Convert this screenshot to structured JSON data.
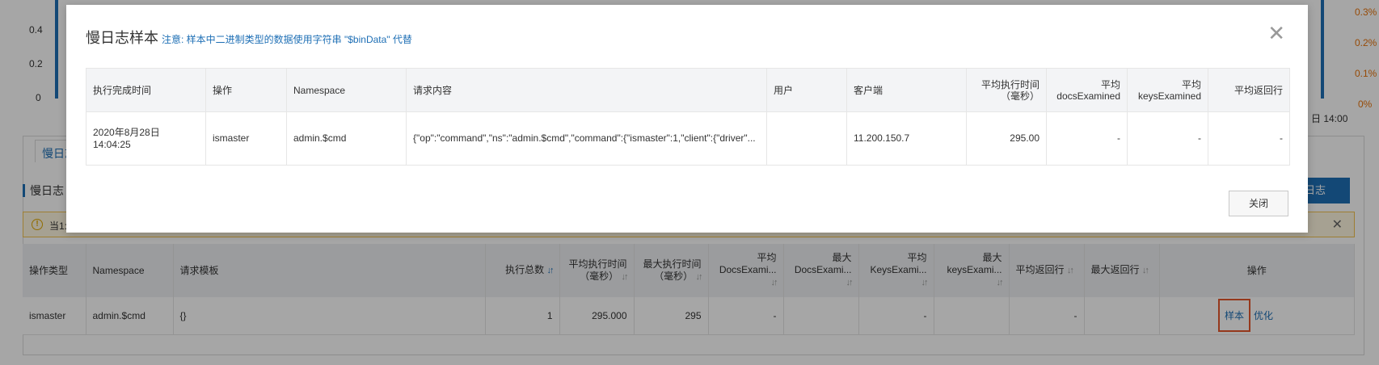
{
  "background": {
    "chart": {
      "y_left_ticks": [
        "0.4",
        "0.2",
        "0"
      ],
      "y_right_ticks": [
        "0.3%",
        "0.2%",
        "0.1%",
        "0%"
      ],
      "x_tick_right": "日 14:00"
    },
    "tab_label": "慢日志",
    "subhead": "慢日志",
    "action_button": "日志",
    "notice_text": "当1:"
  },
  "bottom_table": {
    "headers": [
      "操作类型",
      "Namespace",
      "请求模板",
      "执行总数",
      "平均执行时间（毫秒）",
      "最大执行时间（毫秒）",
      "平均 DocsExami...",
      "最大 DocsExami...",
      "平均 KeysExami...",
      "最大 keysExami...",
      "平均返回行",
      "最大返回行",
      "操作"
    ],
    "row": {
      "op_type": "ismaster",
      "namespace": "admin.$cmd",
      "template": "{}",
      "total": "1",
      "avg_time": "295.000",
      "max_time": "295",
      "avg_docs": "-",
      "max_docs": "",
      "avg_keys": "-",
      "max_keys": "",
      "avg_ret": "-",
      "max_ret": "",
      "action_sample": "样本",
      "action_optimize": "优化"
    }
  },
  "modal": {
    "title": "慢日志样本",
    "note": "注意: 样本中二进制类型的数据使用字符串 \"$binData\" 代替",
    "headers": [
      "执行完成时间",
      "操作",
      "Namespace",
      "请求内容",
      "用户",
      "客户端",
      "平均执行时间（毫秒）",
      "平均 docsExamined",
      "平均 keysExamined",
      "平均返回行"
    ],
    "row": {
      "finish_time": "2020年8月28日 14:04:25",
      "operation": "ismaster",
      "namespace": "admin.$cmd",
      "request": "{\"op\":\"command\",\"ns\":\"admin.$cmd\",\"command\":{\"ismaster\":1,\"client\":{\"driver\"...",
      "user": "",
      "client": "11.200.150.7",
      "avg_time": "295.00",
      "docs_examined": "-",
      "keys_examined": "-",
      "returned": "-"
    },
    "close_button": "关闭"
  }
}
